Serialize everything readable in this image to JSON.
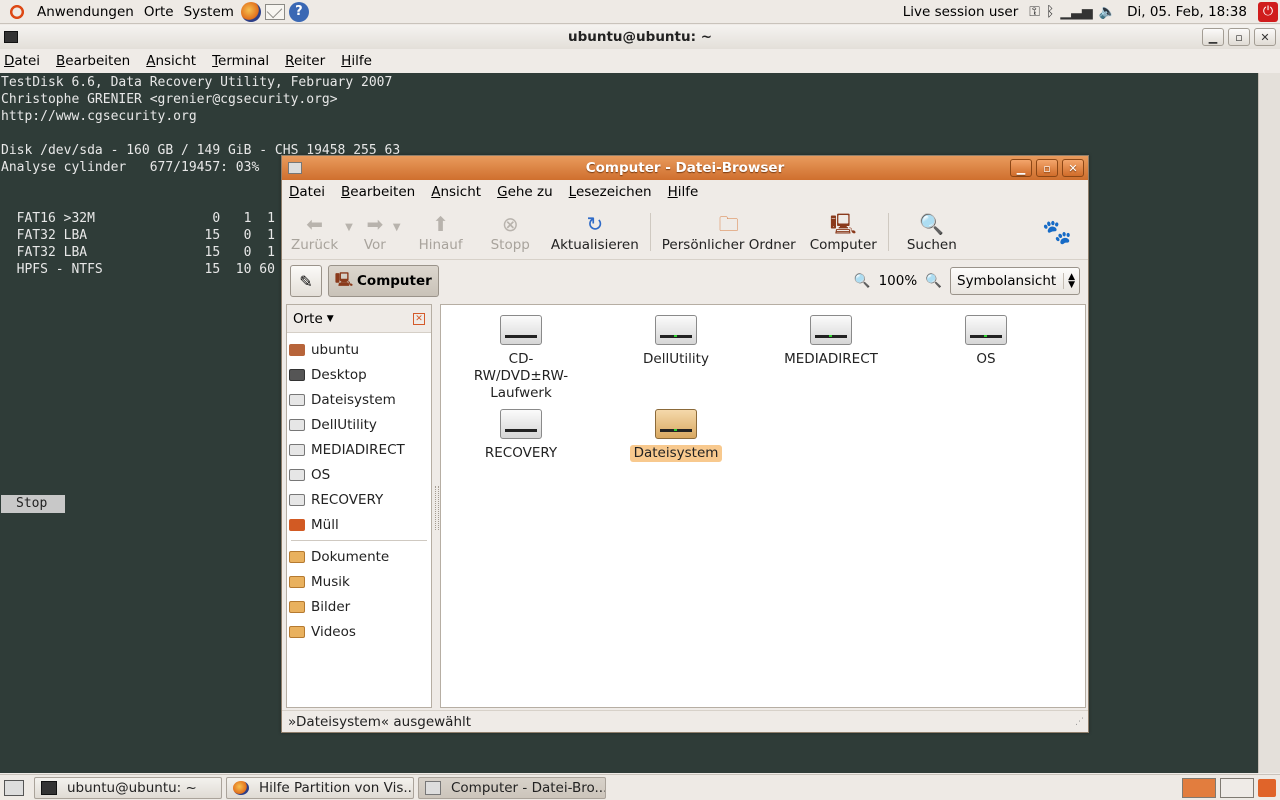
{
  "top_panel": {
    "menus": [
      "Anwendungen",
      "Orte",
      "System"
    ],
    "user": "Live session user",
    "clock": "Di, 05. Feb, 18:38"
  },
  "terminal": {
    "title": "ubuntu@ubuntu: ~",
    "menus": [
      "Datei",
      "Bearbeiten",
      "Ansicht",
      "Terminal",
      "Reiter",
      "Hilfe"
    ],
    "lines": [
      "TestDisk 6.6, Data Recovery Utility, February 2007",
      "Christophe GRENIER <grenier@cgsecurity.org>",
      "http://www.cgsecurity.org",
      "",
      "Disk /dev/sda - 160 GB / 149 GiB - CHS 19458 255 63",
      "Analyse cylinder   677/19457: 03%",
      "",
      "",
      "  FAT16 >32M               0   1  1",
      "  FAT32 LBA               15   0  1",
      "  FAT32 LBA               15   0  1",
      "  HPFS - NTFS             15  10 60"
    ],
    "stop": "Stop"
  },
  "file_browser": {
    "title": "Computer - Datei-Browser",
    "menus": [
      "Datei",
      "Bearbeiten",
      "Ansicht",
      "Gehe zu",
      "Lesezeichen",
      "Hilfe"
    ],
    "toolbar": {
      "back": "Zurück",
      "forward": "Vor",
      "up": "Hinauf",
      "stop": "Stopp",
      "reload": "Aktualisieren",
      "home": "Persönlicher Ordner",
      "computer": "Computer",
      "search": "Suchen"
    },
    "location": "Computer",
    "zoom": "100%",
    "view_mode": "Symbolansicht",
    "sidebar_header": "Orte",
    "places": [
      "ubuntu",
      "Desktop",
      "Dateisystem",
      "DellUtility",
      "MEDIADIRECT",
      "OS",
      "RECOVERY",
      "Müll"
    ],
    "bookmarks": [
      "Dokumente",
      "Musik",
      "Bilder",
      "Videos"
    ],
    "items": [
      "CD-RW/DVD±RW-Laufwerk",
      "DellUtility",
      "MEDIADIRECT",
      "OS",
      "RECOVERY",
      "Dateisystem"
    ],
    "status": "»Dateisystem« ausgewählt"
  },
  "taskbar": {
    "items": [
      "ubuntu@ubuntu: ~",
      "Hilfe Partition von Vis...",
      "Computer - Datei-Bro..."
    ]
  }
}
